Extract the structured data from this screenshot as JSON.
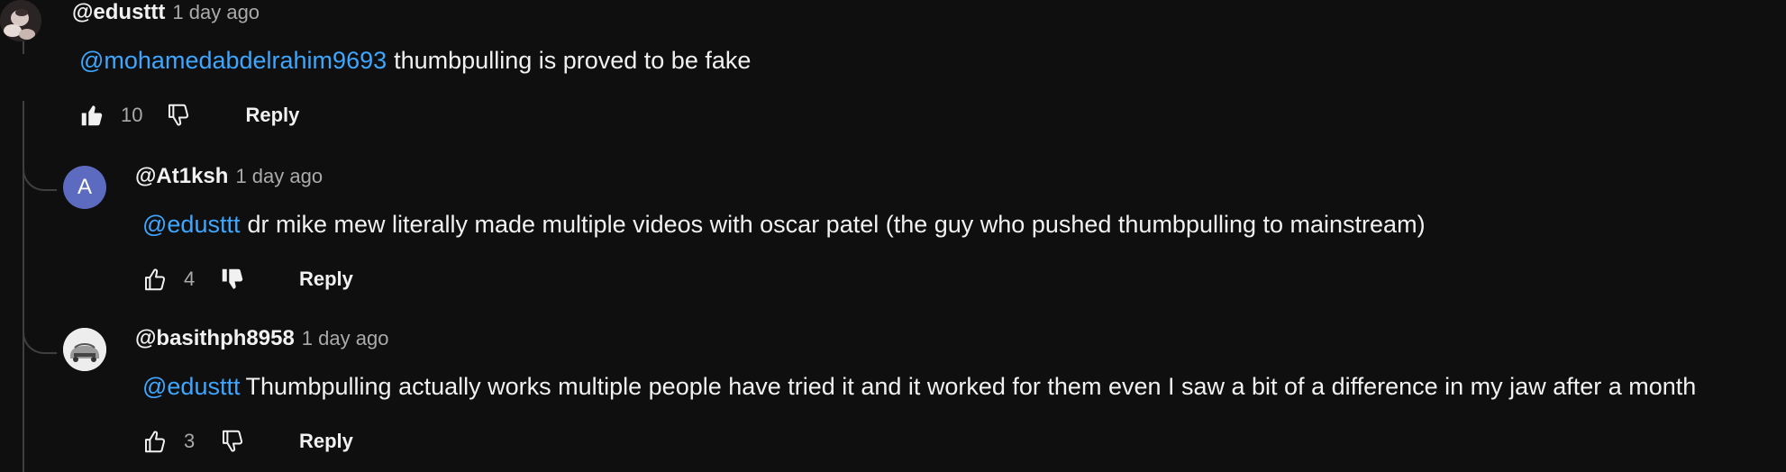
{
  "comments": [
    {
      "author": "@edusttt",
      "time": "1 day ago",
      "mention": "@mohamedabdelrahim9693",
      "text": "thumbpulling is proved to be fake",
      "likes": "10",
      "reply_label": "Reply",
      "avatar": "photo-avatar",
      "liked": true,
      "disliked": false
    },
    {
      "author": "@At1ksh",
      "time": "1 day ago",
      "avatar_letter": "A",
      "mention": "@edusttt",
      "text": "dr mike mew literally made multiple videos with oscar patel (the guy who pushed thumbpulling to mainstream)",
      "likes": "4",
      "reply_label": "Reply",
      "liked": false,
      "disliked": true
    },
    {
      "author": "@basithph8958",
      "time": "1 day ago",
      "avatar": "car-avatar",
      "mention": "@edusttt",
      "text": "Thumbpulling actually works multiple people have tried it and it worked for them even I saw a bit of a difference in my jaw after a month",
      "likes": "3",
      "reply_label": "Reply",
      "liked": false,
      "disliked": false
    }
  ],
  "colors": {
    "background": "#0f0f0f",
    "text": "#f1f1f1",
    "secondary": "#aaaaaa",
    "mention": "#3ea6ff",
    "avatar_letter_bg": "#5c6bc0"
  }
}
